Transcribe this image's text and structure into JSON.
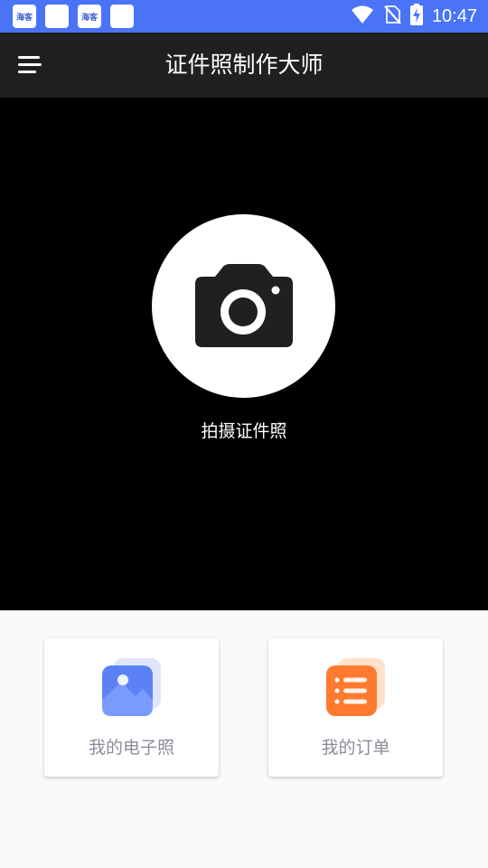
{
  "status_bar": {
    "notifications": [
      {
        "icon": "app-notification-icon",
        "text": "海客"
      },
      {
        "icon": "blank-notification-icon",
        "text": ""
      },
      {
        "icon": "app-notification-icon",
        "text": "海客"
      },
      {
        "icon": "blank-notification-icon",
        "text": ""
      }
    ],
    "time": "10:47",
    "icons": [
      "wifi-icon",
      "no-sim-icon",
      "battery-charging-icon"
    ]
  },
  "app_bar": {
    "title": "证件照制作大师",
    "menu_icon": "menu-icon"
  },
  "camera": {
    "button_icon": "camera-icon",
    "label": "拍摄证件照"
  },
  "cards": [
    {
      "label": "我的电子照",
      "icon": "photo-icon",
      "color": "#4a74f5"
    },
    {
      "label": "我的订单",
      "icon": "order-list-icon",
      "color": "#ff7a2e"
    }
  ],
  "colors": {
    "status_bar": "#4a74f5",
    "app_bar": "#1f2022",
    "camera_area": "#000000",
    "page_background": "#fafafa"
  }
}
